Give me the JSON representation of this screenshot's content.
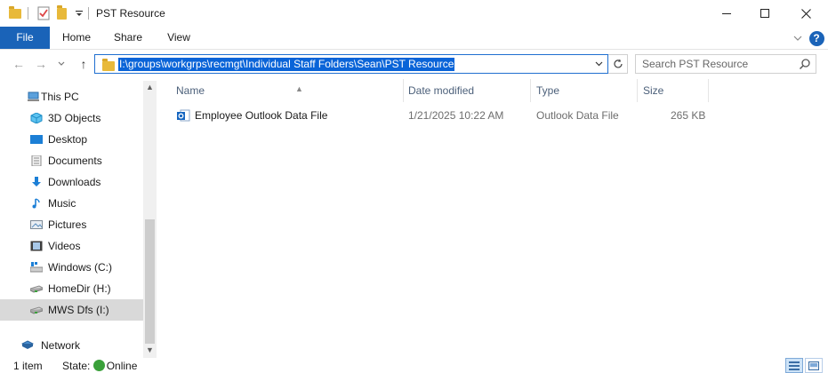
{
  "window": {
    "title": "PST Resource",
    "minimize_glyph": "—",
    "maximize_glyph": "☐",
    "close_glyph": "✕"
  },
  "ribbon": {
    "tabs": [
      "File",
      "Home",
      "Share",
      "View"
    ],
    "expand_glyph": "⌄",
    "help_glyph": "?"
  },
  "address": {
    "path": "I:\\groups\\workgrps\\recmgt\\Individual Staff Folders\\Sean\\PST Resource",
    "back_glyph": "←",
    "forward_glyph": "→",
    "recent_glyph": "⌄",
    "up_glyph": "↑",
    "dropdown_glyph": "⌄"
  },
  "search": {
    "placeholder": "Search PST Resource"
  },
  "nav": {
    "items": [
      {
        "label": "This PC",
        "icon": "this-pc-icon"
      },
      {
        "label": "3D Objects",
        "icon": "3d-objects-icon"
      },
      {
        "label": "Desktop",
        "icon": "desktop-icon"
      },
      {
        "label": "Documents",
        "icon": "documents-icon"
      },
      {
        "label": "Downloads",
        "icon": "downloads-icon"
      },
      {
        "label": "Music",
        "icon": "music-icon"
      },
      {
        "label": "Pictures",
        "icon": "pictures-icon"
      },
      {
        "label": "Videos",
        "icon": "videos-icon"
      },
      {
        "label": "Windows (C:)",
        "icon": "drive-c-icon"
      },
      {
        "label": "HomeDir (H:)",
        "icon": "network-drive-icon"
      },
      {
        "label": "MWS Dfs (I:)",
        "icon": "network-drive-icon",
        "selected": true
      },
      {
        "label": "Network",
        "icon": "network-icon"
      }
    ]
  },
  "columns": {
    "name": "Name",
    "date": "Date modified",
    "type": "Type",
    "size": "Size"
  },
  "files": [
    {
      "name": "Employee Outlook Data File",
      "date": "1/21/2025 10:22 AM",
      "type": "Outlook Data File",
      "size": "265 KB",
      "icon": "outlook-pst-icon"
    }
  ],
  "status": {
    "count": "1 item",
    "state_label": "State:",
    "state_value": "Online"
  },
  "colors": {
    "accent": "#1a63b8",
    "selection": "#0a64d8",
    "header_text": "#4c607a",
    "online": "#3aa03a"
  }
}
